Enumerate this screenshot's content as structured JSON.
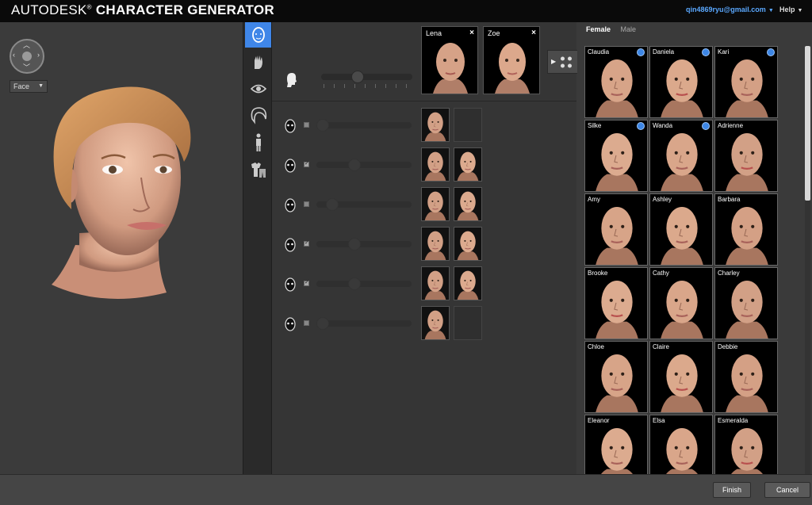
{
  "header": {
    "brand_a": "AUTODESK",
    "trademark": "®",
    "brand_b": "CHARACTER GENERATOR",
    "user_email": "qin4869ryu@gmail.com",
    "help": "Help"
  },
  "viewport": {
    "mode_select": "Face"
  },
  "toolbar": {
    "icons": [
      "face-icon",
      "skin-hand-icon",
      "eye-icon",
      "hair-icon",
      "body-icon",
      "clothing-icon"
    ],
    "active_index": 0
  },
  "blend": {
    "parents": [
      {
        "name": "Lena",
        "close": "×"
      },
      {
        "name": "Zoe",
        "close": "×"
      }
    ],
    "main_slider_value": 0.38
  },
  "features": [
    {
      "icon": "eyes-feature-icon",
      "checked": false,
      "slider": 0.0,
      "thumbs": 1
    },
    {
      "icon": "nose-feature-icon",
      "checked": true,
      "slider": 0.38,
      "thumbs": 2
    },
    {
      "icon": "mouth-feature-icon",
      "checked": false,
      "slider": 0.12,
      "thumbs": 2
    },
    {
      "icon": "jaw-feature-icon",
      "checked": true,
      "slider": 0.38,
      "thumbs": 2
    },
    {
      "icon": "ears-feature-icon",
      "checked": true,
      "slider": 0.38,
      "thumbs": 2
    },
    {
      "icon": "brows-feature-icon",
      "checked": false,
      "slider": 0.0,
      "thumbs": 1
    }
  ],
  "gallery": {
    "tabs": [
      "Female",
      "Male"
    ],
    "selected_tab": "Female",
    "characters": [
      {
        "name": "Claudia",
        "custom": true
      },
      {
        "name": "Daniela",
        "custom": true
      },
      {
        "name": "Kari",
        "custom": true
      },
      {
        "name": "Silke",
        "custom": true
      },
      {
        "name": "Wanda",
        "custom": true
      },
      {
        "name": "Adrienne",
        "custom": false
      },
      {
        "name": "Amy",
        "custom": false
      },
      {
        "name": "Ashley",
        "custom": false
      },
      {
        "name": "Barbara",
        "custom": false
      },
      {
        "name": "Brooke",
        "custom": false
      },
      {
        "name": "Cathy",
        "custom": false
      },
      {
        "name": "Charley",
        "custom": false
      },
      {
        "name": "Chloe",
        "custom": false
      },
      {
        "name": "Claire",
        "custom": false
      },
      {
        "name": "Debbie",
        "custom": false
      },
      {
        "name": "Eleanor",
        "custom": false
      },
      {
        "name": "Elsa",
        "custom": false
      },
      {
        "name": "Esmeralda",
        "custom": false
      }
    ]
  },
  "footer": {
    "finish": "Finish",
    "cancel": "Cancel"
  },
  "colors": {
    "accent": "#3f86e8",
    "link": "#5aa8ff",
    "skin": "#d9a488",
    "hair": "#c7874f"
  }
}
